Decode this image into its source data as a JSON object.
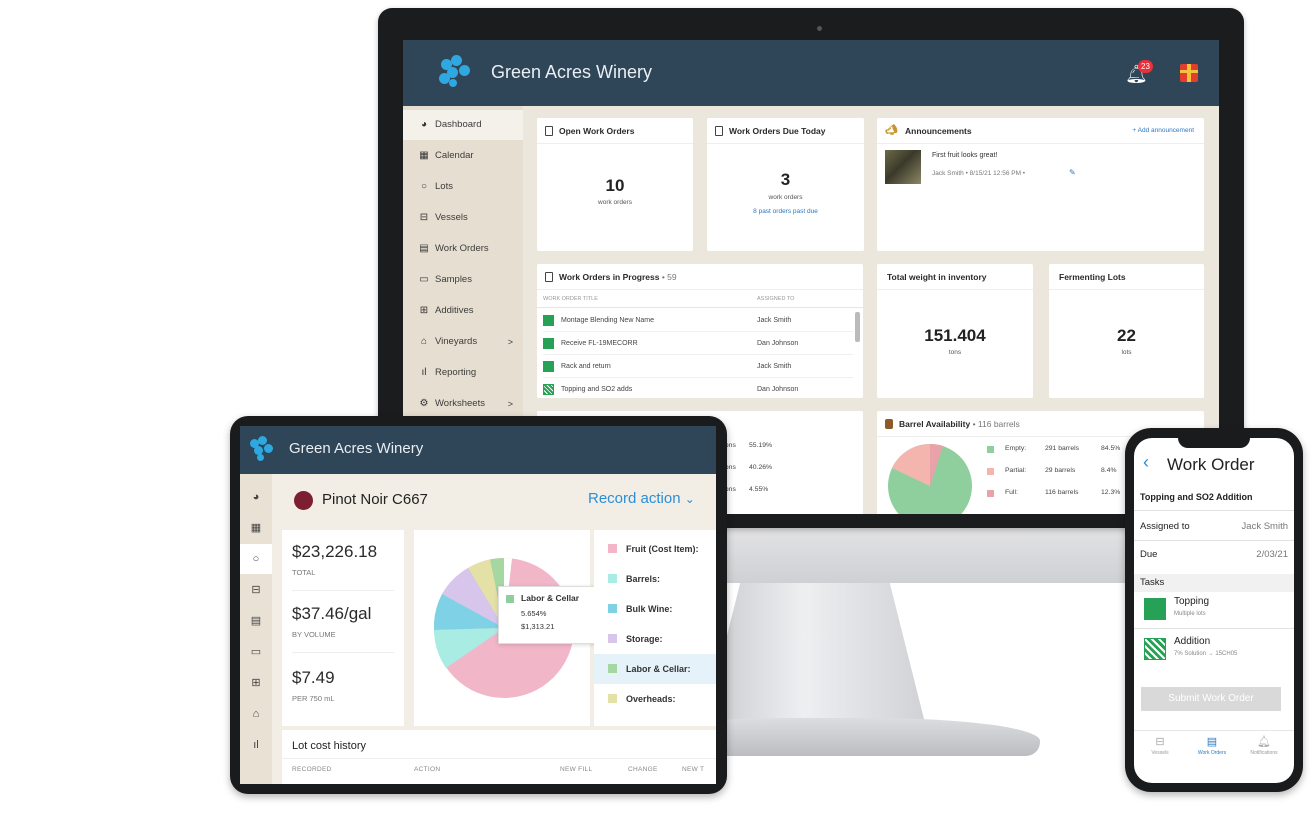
{
  "brand": "Green Acres Winery",
  "monitor": {
    "notification_count": "23",
    "sidebar": [
      {
        "label": "Dashboard",
        "icon": "dashboard-icon",
        "glyph": "◕"
      },
      {
        "label": "Calendar",
        "icon": "calendar-icon",
        "glyph": "▦"
      },
      {
        "label": "Lots",
        "icon": "lots-icon",
        "glyph": "○"
      },
      {
        "label": "Vessels",
        "icon": "vessel-icon",
        "glyph": "⊟"
      },
      {
        "label": "Work Orders",
        "icon": "clipboard-icon",
        "glyph": "▤"
      },
      {
        "label": "Samples",
        "icon": "sample-icon",
        "glyph": "▭"
      },
      {
        "label": "Additives",
        "icon": "additives-icon",
        "glyph": "⊞"
      },
      {
        "label": "Vineyards",
        "icon": "barn-icon",
        "glyph": "⌂",
        "caret": ">"
      },
      {
        "label": "Reporting",
        "icon": "bar-chart-icon",
        "glyph": "ıl"
      },
      {
        "label": "Worksheets",
        "icon": "worksheet-icon",
        "glyph": "⚙",
        "caret": ">"
      }
    ],
    "open_work_orders": {
      "title": "Open Work Orders",
      "value": "10",
      "unit": "work orders"
    },
    "due_today": {
      "title": "Work Orders Due Today",
      "value": "3",
      "unit": "work orders",
      "link": "8 past orders past due"
    },
    "announcements": {
      "title": "Announcements",
      "add": "+ Add announcement",
      "text": "First fruit looks great!",
      "meta": "Jack Smith • 8/15/21 12:56 PM •"
    },
    "in_progress": {
      "title": "Work Orders in Progress",
      "count": "• 59",
      "col_title": "WORK ORDER TITLE",
      "col_assigned": "ASSIGNED TO",
      "rows": [
        {
          "title": "Montage Blending New Name",
          "assigned": "Jack Smith",
          "style": "solid"
        },
        {
          "title": "Receive FL-19MECORR",
          "assigned": "Dan Johnson",
          "style": "solid"
        },
        {
          "title": "Rack and return",
          "assigned": "Jack Smith",
          "style": "solid"
        },
        {
          "title": "Topping and SO2 adds",
          "assigned": "Dan Johnson",
          "style": "hatch"
        }
      ]
    },
    "total_weight": {
      "title": "Total weight in inventory",
      "value": "151.404",
      "unit": "tons"
    },
    "fermenting": {
      "title": "Fermenting Lots",
      "value": "22",
      "unit": "lots"
    },
    "partial_card": {
      "rows": [
        {
          "label": "tons",
          "pct": "55.19%"
        },
        {
          "label": "tons",
          "pct": "40.26%"
        },
        {
          "label": "tons",
          "pct": "4.55%"
        }
      ]
    },
    "barrel": {
      "title": "Barrel Availability",
      "count": "• 116 barrels",
      "rows": [
        {
          "label": "Empty:",
          "count": "291 barrels",
          "pct": "84.5%",
          "color": "#8fcf9d"
        },
        {
          "label": "Partial:",
          "count": "29 barrels",
          "pct": "8.4%",
          "color": "#f3b5ad"
        },
        {
          "label": "Full:",
          "count": "116 barrels",
          "pct": "12.3%",
          "color": "#e8a2a8"
        }
      ]
    }
  },
  "tablet": {
    "lot_name": "Pinot Noir C667",
    "record_action": "Record action",
    "stats": [
      {
        "value": "$23,226.18",
        "label": "TOTAL"
      },
      {
        "value": "$37.46/gal",
        "label": "BY VOLUME"
      },
      {
        "value": "$7.49",
        "label": "PER 750 mL"
      }
    ],
    "tooltip": {
      "label": "Labor & Cellar",
      "pct": "5.654%",
      "amount": "$1,313.21"
    },
    "cost_items": [
      {
        "label": "Fruit (Cost Item):",
        "color": "#f2b6c9"
      },
      {
        "label": "Barrels:",
        "color": "#a9ece4"
      },
      {
        "label": "Bulk Wine:",
        "color": "#7fd2e6"
      },
      {
        "label": "Storage:",
        "color": "#d7c5ec"
      },
      {
        "label": "Labor & Cellar:",
        "color": "#a4d8a0"
      },
      {
        "label": "Overheads:",
        "color": "#e4e1a7"
      }
    ],
    "history": {
      "title": "Lot cost history",
      "cols": [
        "RECORDED",
        "ACTION",
        "NEW FILL",
        "CHANGE",
        "NEW T"
      ]
    }
  },
  "phone": {
    "title": "Work Order",
    "subtitle": "Topping and SO2 Addition",
    "assigned_label": "Assigned to",
    "assigned_value": "Jack Smith",
    "due_label": "Due",
    "due_value": "2/03/21",
    "tasks_label": "Tasks",
    "tasks": [
      {
        "title": "Topping",
        "sub": "Multiple lots",
        "style": "solid"
      },
      {
        "title": "Addition",
        "sub": "7% Solution → 15CH05",
        "style": "hatch"
      }
    ],
    "submit": "Submit Work Order",
    "nav": [
      "Vessels",
      "Work Orders",
      "Notifications"
    ]
  }
}
